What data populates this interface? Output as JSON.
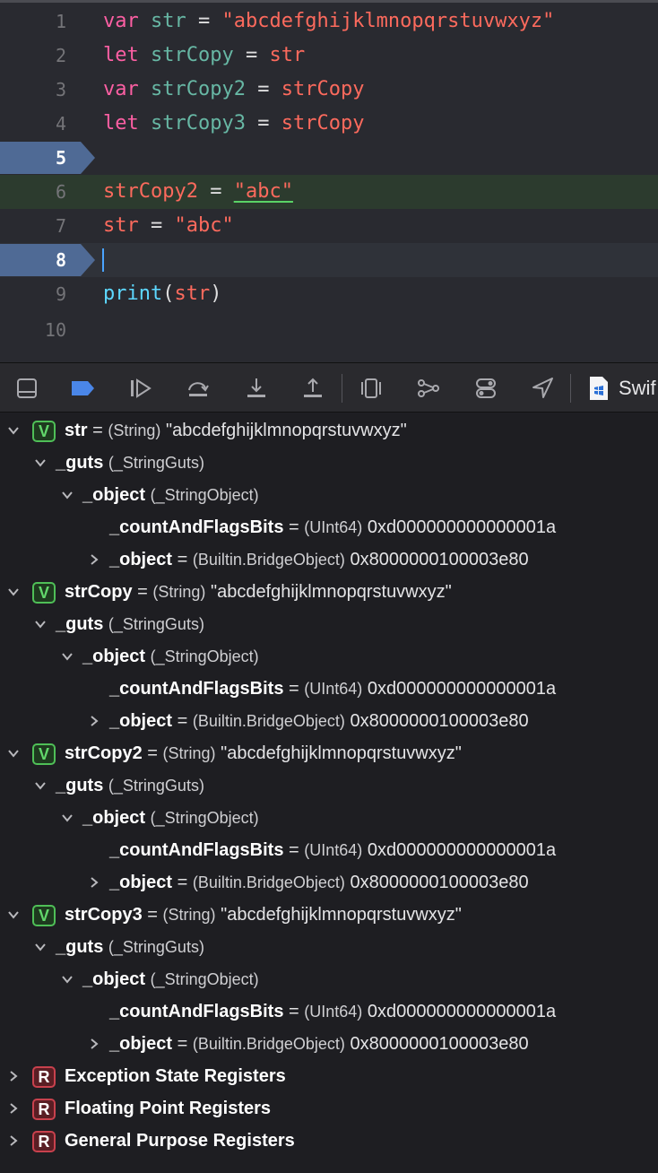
{
  "editor": {
    "lines": [
      {
        "n": "1"
      },
      {
        "n": "2"
      },
      {
        "n": "3"
      },
      {
        "n": "4"
      },
      {
        "n": "5"
      },
      {
        "n": "6"
      },
      {
        "n": "7"
      },
      {
        "n": "8"
      },
      {
        "n": "9"
      },
      {
        "n": "10"
      }
    ],
    "code": {
      "l1": {
        "kw": "var",
        "name": "str",
        "eq": "=",
        "value": "\"abcdefghijklmnopqrstuvwxyz\""
      },
      "l2": {
        "kw": "let",
        "name": "strCopy",
        "eq": "=",
        "value": "str"
      },
      "l3": {
        "kw": "var",
        "name": "strCopy2",
        "eq": "=",
        "value": "strCopy"
      },
      "l4": {
        "kw": "let",
        "name": "strCopy3",
        "eq": "=",
        "value": "strCopy"
      },
      "l6": {
        "name": "strCopy2",
        "eq": "=",
        "value": "\"abc\""
      },
      "l7": {
        "name": "str",
        "eq": "=",
        "value": "\"abc\""
      },
      "l9": {
        "fn": "print",
        "open": "(",
        "arg": "str",
        "close": ")"
      }
    },
    "breakpoint_lines": [
      "5",
      "8"
    ],
    "current_line": "8",
    "changed_line": "6"
  },
  "debugbar": {
    "buttons": [
      {
        "icon": "hide-debug-area-icon"
      },
      {
        "icon": "breakpoints-toggle-icon",
        "active": true
      },
      {
        "icon": "continue-icon"
      },
      {
        "icon": "step-over-icon"
      },
      {
        "icon": "step-into-icon"
      },
      {
        "icon": "step-out-icon"
      },
      {
        "icon": "debug-view-hierarchy-icon"
      },
      {
        "icon": "memory-graph-icon"
      },
      {
        "icon": "environment-overrides-icon"
      },
      {
        "icon": "simulate-location-icon"
      }
    ],
    "target_label": "Swif"
  },
  "variables": [
    {
      "level": 0,
      "expand": "open",
      "badge": "V",
      "name": "str",
      "eq": "=",
      "type": "(String)",
      "value": "\"abcdefghijklmnopqrstuvwxyz\""
    },
    {
      "level": 1,
      "expand": "open",
      "name": "_guts",
      "type": "(_StringGuts)"
    },
    {
      "level": 2,
      "expand": "open",
      "name": "_object",
      "type": "(_StringObject)"
    },
    {
      "level": 3,
      "expand": "none",
      "name": "_countAndFlagsBits",
      "eq": "=",
      "type": "(UInt64)",
      "value": "0xd000000000000001a"
    },
    {
      "level": 3,
      "expand": "closed",
      "name": "_object",
      "eq": "=",
      "type": "(Builtin.BridgeObject)",
      "value": "0x8000000100003e80"
    },
    {
      "level": 0,
      "expand": "open",
      "badge": "V",
      "name": "strCopy",
      "eq": "=",
      "type": "(String)",
      "value": "\"abcdefghijklmnopqrstuvwxyz\""
    },
    {
      "level": 1,
      "expand": "open",
      "name": "_guts",
      "type": "(_StringGuts)"
    },
    {
      "level": 2,
      "expand": "open",
      "name": "_object",
      "type": "(_StringObject)"
    },
    {
      "level": 3,
      "expand": "none",
      "name": "_countAndFlagsBits",
      "eq": "=",
      "type": "(UInt64)",
      "value": "0xd000000000000001a"
    },
    {
      "level": 3,
      "expand": "closed",
      "name": "_object",
      "eq": "=",
      "type": "(Builtin.BridgeObject)",
      "value": "0x8000000100003e80"
    },
    {
      "level": 0,
      "expand": "open",
      "badge": "V",
      "name": "strCopy2",
      "eq": "=",
      "type": "(String)",
      "value": "\"abcdefghijklmnopqrstuvwxyz\""
    },
    {
      "level": 1,
      "expand": "open",
      "name": "_guts",
      "type": "(_StringGuts)"
    },
    {
      "level": 2,
      "expand": "open",
      "name": "_object",
      "type": "(_StringObject)"
    },
    {
      "level": 3,
      "expand": "none",
      "name": "_countAndFlagsBits",
      "eq": "=",
      "type": "(UInt64)",
      "value": "0xd000000000000001a"
    },
    {
      "level": 3,
      "expand": "closed",
      "name": "_object",
      "eq": "=",
      "type": "(Builtin.BridgeObject)",
      "value": "0x8000000100003e80"
    },
    {
      "level": 0,
      "expand": "open",
      "badge": "V",
      "name": "strCopy3",
      "eq": "=",
      "type": "(String)",
      "value": "\"abcdefghijklmnopqrstuvwxyz\""
    },
    {
      "level": 1,
      "expand": "open",
      "name": "_guts",
      "type": "(_StringGuts)"
    },
    {
      "level": 2,
      "expand": "open",
      "name": "_object",
      "type": "(_StringObject)"
    },
    {
      "level": 3,
      "expand": "none",
      "name": "_countAndFlagsBits",
      "eq": "=",
      "type": "(UInt64)",
      "value": "0xd000000000000001a"
    },
    {
      "level": 3,
      "expand": "closed",
      "name": "_object",
      "eq": "=",
      "type": "(Builtin.BridgeObject)",
      "value": "0x8000000100003e80"
    },
    {
      "level": 0,
      "expand": "closed",
      "badge": "R",
      "title": "Exception State Registers"
    },
    {
      "level": 0,
      "expand": "closed",
      "badge": "R",
      "title": "Floating Point Registers"
    },
    {
      "level": 0,
      "expand": "closed",
      "badge": "R",
      "title": "General Purpose Registers"
    }
  ]
}
